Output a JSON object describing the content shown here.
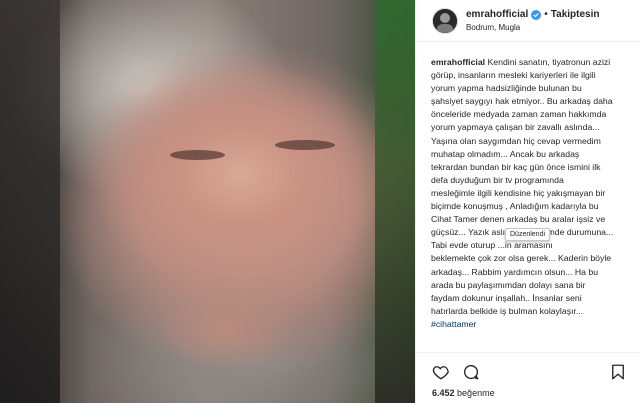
{
  "post": {
    "username": "emrahofficial",
    "separator": "•",
    "follow_label": "Takiptesin",
    "location": "Bodrum, Mugla",
    "caption_user": "emrahofficial",
    "caption_lines": [
      "Kendini sanatın, tiyatronun azizi",
      "görüp, insanların mesleki kariyerleri ile ilgili",
      "yorum yapma hadsizliğinde bulunan bu",
      "şahsiyet saygıyı hak etmiyor.. Bu arkadaş daha",
      "önceleride medyada zaman zaman hakkımda",
      "yorum yapmaya çalışan bir zavallı aslında...",
      "Yaşına olan saygımdan hiç cevap vermedim",
      "muhatap olmadım... Ancak bu arkadaş",
      "tekrardan bundan bir kaç gün önce ismini ilk",
      "defa duyduğum bir tv programında",
      "mesleğimle ilgili kendisine hiç yakışmayan bir",
      "biçimde konuşmuş , Anladığım kadarıyla bu",
      "Cihat Tamer denen arkadaş bu aralar işsiz ve",
      "güçsüz... Yazık aslında üzüldümde durumuna...",
      "Tabi evde oturup ...in aramasını",
      "beklemekte çok zor olsa gerek... Kaderin böyle",
      "arkadaş... Rabbim yardımcın olsun... Ha bu",
      "arada bu paylaşımımdan dolayı sana bir",
      "faydam dokunur inşallah.. İnsanlar seni",
      "hatırlarda belkide iş bulman kolaylaşır..."
    ],
    "hashtag": "#cihattamer",
    "tooltip": "Düzenlendi",
    "likes_count": "6.452",
    "likes_label": "beğenme"
  },
  "colors": {
    "text": "#262626",
    "verified": "#3897f0",
    "hashtag": "#003569",
    "border": "#efefef"
  },
  "icons": {
    "like": "heart-icon",
    "comment": "comment-bubble-icon",
    "save": "bookmark-icon",
    "verified": "verified-badge-icon"
  }
}
